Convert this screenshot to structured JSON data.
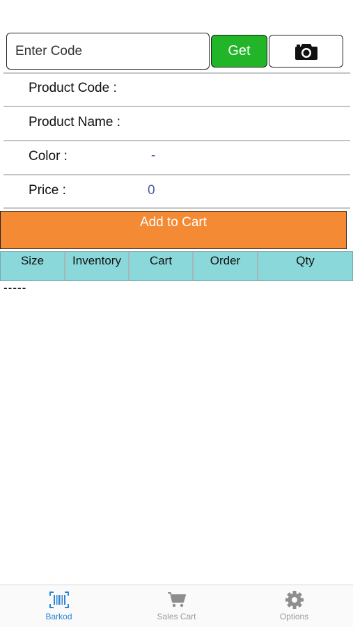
{
  "search": {
    "placeholder": "Enter Code",
    "value": ""
  },
  "buttons": {
    "get_label": "Get",
    "camera_icon": "camera-icon",
    "add_to_cart_label": "Add to Cart"
  },
  "fields": [
    {
      "label": "Product Code :",
      "value": ""
    },
    {
      "label": "Product Name :",
      "value": ""
    },
    {
      "label": "Color :",
      "value": "-"
    },
    {
      "label": "Price :",
      "value": "0"
    }
  ],
  "table": {
    "columns": [
      "Size",
      "Inventory",
      "Cart",
      "Order",
      "Qty"
    ],
    "empty_text": "-----"
  },
  "tabbar": {
    "items": [
      {
        "label": "Barkod",
        "icon": "barcode-icon",
        "active": true
      },
      {
        "label": "Sales Cart",
        "icon": "cart-icon",
        "active": false
      },
      {
        "label": "Options",
        "icon": "gear-icon",
        "active": false
      }
    ]
  },
  "colors": {
    "get_button": "#22b528",
    "add_button": "#f48a34",
    "table_header": "#8ad8da",
    "active_tab": "#2b86d4"
  }
}
